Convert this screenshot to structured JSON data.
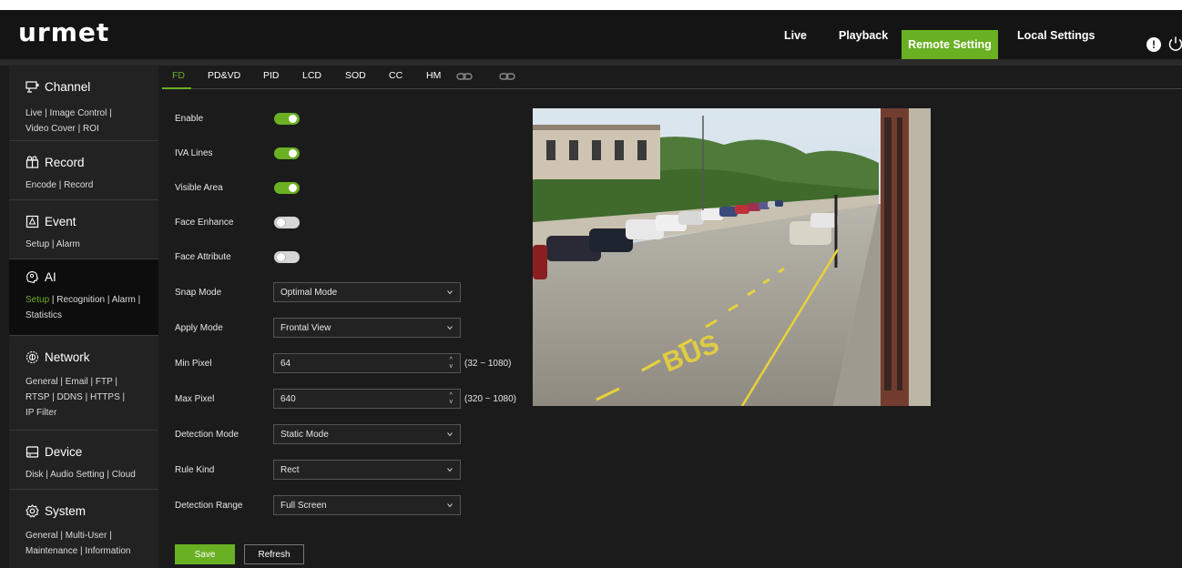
{
  "header": {
    "logo": "urmet",
    "nav": [
      "Live",
      "Playback",
      "Remote Setting",
      "Local Settings"
    ],
    "alert_icon_glyph": "!",
    "accent": "#6ab023"
  },
  "sidebar": {
    "sections": [
      {
        "title": "Channel",
        "icon": "channel-icon",
        "links": [
          "Live",
          "Image Control",
          "Video Cover",
          "ROI"
        ]
      },
      {
        "title": "Record",
        "icon": "record-icon",
        "links": [
          "Encode",
          "Record"
        ]
      },
      {
        "title": "Event",
        "icon": "event-icon",
        "links": [
          "Setup",
          "Alarm"
        ]
      },
      {
        "title": "AI",
        "icon": "ai-icon",
        "links": [
          "Setup",
          "Recognition",
          "Alarm",
          "Statistics"
        ],
        "active_link": "Setup"
      },
      {
        "title": "Network",
        "icon": "network-icon",
        "links": [
          "General",
          "Email",
          "FTP",
          "RTSP",
          "DDNS",
          "HTTPS",
          "IP Filter"
        ]
      },
      {
        "title": "Device",
        "icon": "device-icon",
        "links": [
          "Disk",
          "Audio Setting",
          "Cloud"
        ]
      },
      {
        "title": "System",
        "icon": "system-icon",
        "links": [
          "General",
          "Multi-User",
          "Maintenance",
          "Information"
        ]
      }
    ]
  },
  "tabs": [
    "FD",
    "PD&VD",
    "PID",
    "LCD",
    "SOD",
    "CC",
    "HM"
  ],
  "form": {
    "enable": {
      "label": "Enable",
      "on": true
    },
    "iva_lines": {
      "label": "IVA Lines",
      "on": true
    },
    "visible_area": {
      "label": "Visible Area",
      "on": true
    },
    "face_enhance": {
      "label": "Face Enhance",
      "on": false
    },
    "face_attribute": {
      "label": "Face Attribute",
      "on": false
    },
    "snap_mode": {
      "label": "Snap Mode",
      "value": "Optimal Mode"
    },
    "apply_mode": {
      "label": "Apply Mode",
      "value": "Frontal View"
    },
    "min_pixel": {
      "label": "Min Pixel",
      "value": "64",
      "range": "(32 ~ 1080)"
    },
    "max_pixel": {
      "label": "Max Pixel",
      "value": "640",
      "range": "(320 ~ 1080)"
    },
    "detection_mode": {
      "label": "Detection Mode",
      "value": "Static Mode"
    },
    "rule_kind": {
      "label": "Rule Kind",
      "value": "Rect"
    },
    "detection_range": {
      "label": "Detection Range",
      "value": "Full Screen"
    }
  },
  "buttons": {
    "save": "Save",
    "refresh": "Refresh"
  },
  "video": {
    "road_marking": "BUS"
  }
}
